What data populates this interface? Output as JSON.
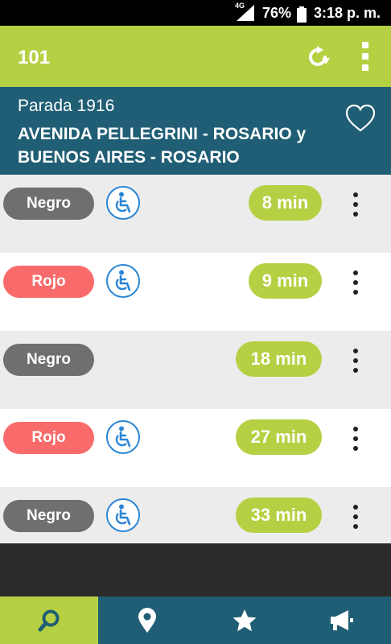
{
  "status": {
    "network": "4G",
    "battery": "76%",
    "time": "3:18 p. m."
  },
  "app": {
    "title": "101",
    "refresh_icon": "refresh-icon",
    "menu_icon": "more-vert-icon"
  },
  "stop": {
    "number_label": "Parada 1916",
    "name": "AVENIDA PELLEGRINI - ROSARIO y BUENOS AIRES - ROSARIO",
    "favorite_icon": "heart-outline-icon"
  },
  "arrivals": [
    {
      "line": "Negro",
      "color": "#6f6f6f",
      "accessible": true,
      "eta": "8 min"
    },
    {
      "line": "Rojo",
      "color": "#f96b6b",
      "accessible": true,
      "eta": "9 min"
    },
    {
      "line": "Negro",
      "color": "#6f6f6f",
      "accessible": false,
      "eta": "18 min"
    },
    {
      "line": "Rojo",
      "color": "#f96b6b",
      "accessible": true,
      "eta": "27 min"
    },
    {
      "line": "Negro",
      "color": "#6f6f6f",
      "accessible": true,
      "eta": "33 min"
    }
  ],
  "bottom_nav": [
    {
      "icon": "search-icon",
      "active": true
    },
    {
      "icon": "location-pin-icon",
      "active": false
    },
    {
      "icon": "star-icon",
      "active": false
    },
    {
      "icon": "megaphone-icon",
      "active": false
    }
  ],
  "colors": {
    "accent": "#b6d043",
    "header": "#1f5e74",
    "accessible": "#2a86d6"
  }
}
